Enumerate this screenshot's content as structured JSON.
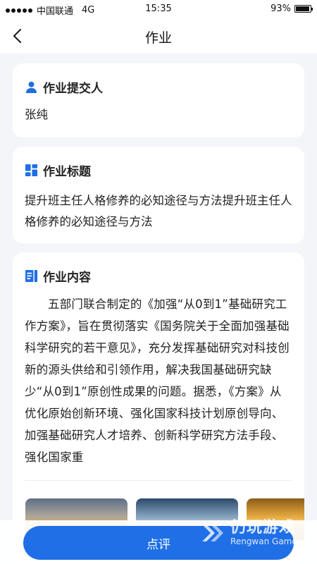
{
  "status_bar": {
    "carrier": "中国联通",
    "network": "4G",
    "time": "15:35",
    "battery_percent": "93%",
    "battery_level": 0.93
  },
  "nav": {
    "title": "作业",
    "back_icon": "chevron-left-icon"
  },
  "submitter_card": {
    "label": "作业提交人",
    "icon": "person-icon",
    "name": "张纯"
  },
  "title_card": {
    "label": "作业标题",
    "icon": "grid-icon",
    "text": "提升班主任人格修养的必知途径与方法提升班主任人格修养的必知途径与方法"
  },
  "content_card": {
    "label": "作业内容",
    "icon": "document-icon",
    "text": "五部门联合制定的《加强“从0到1”基础研究工作方案》，旨在贯彻落实《国务院关于全面加强基础科学研究的若干意见》，充分发挥基础研究对科技创新的源头供给和引领作用，解决我国基础研究缺少“从0到1”原创性成果的问题。据悉，《方案》从优化原始创新环境、强化国家科技计划原创导向、加强基础研究人才培养、创新科学研究方法手段、强化国家重"
  },
  "actions": {
    "review_label": "点评"
  },
  "watermark": {
    "cn": "仍玩游戏",
    "en": "Rengwan Games"
  },
  "colors": {
    "accent": "#1f6fe6",
    "background": "#f3f5f8",
    "card": "#ffffff"
  }
}
